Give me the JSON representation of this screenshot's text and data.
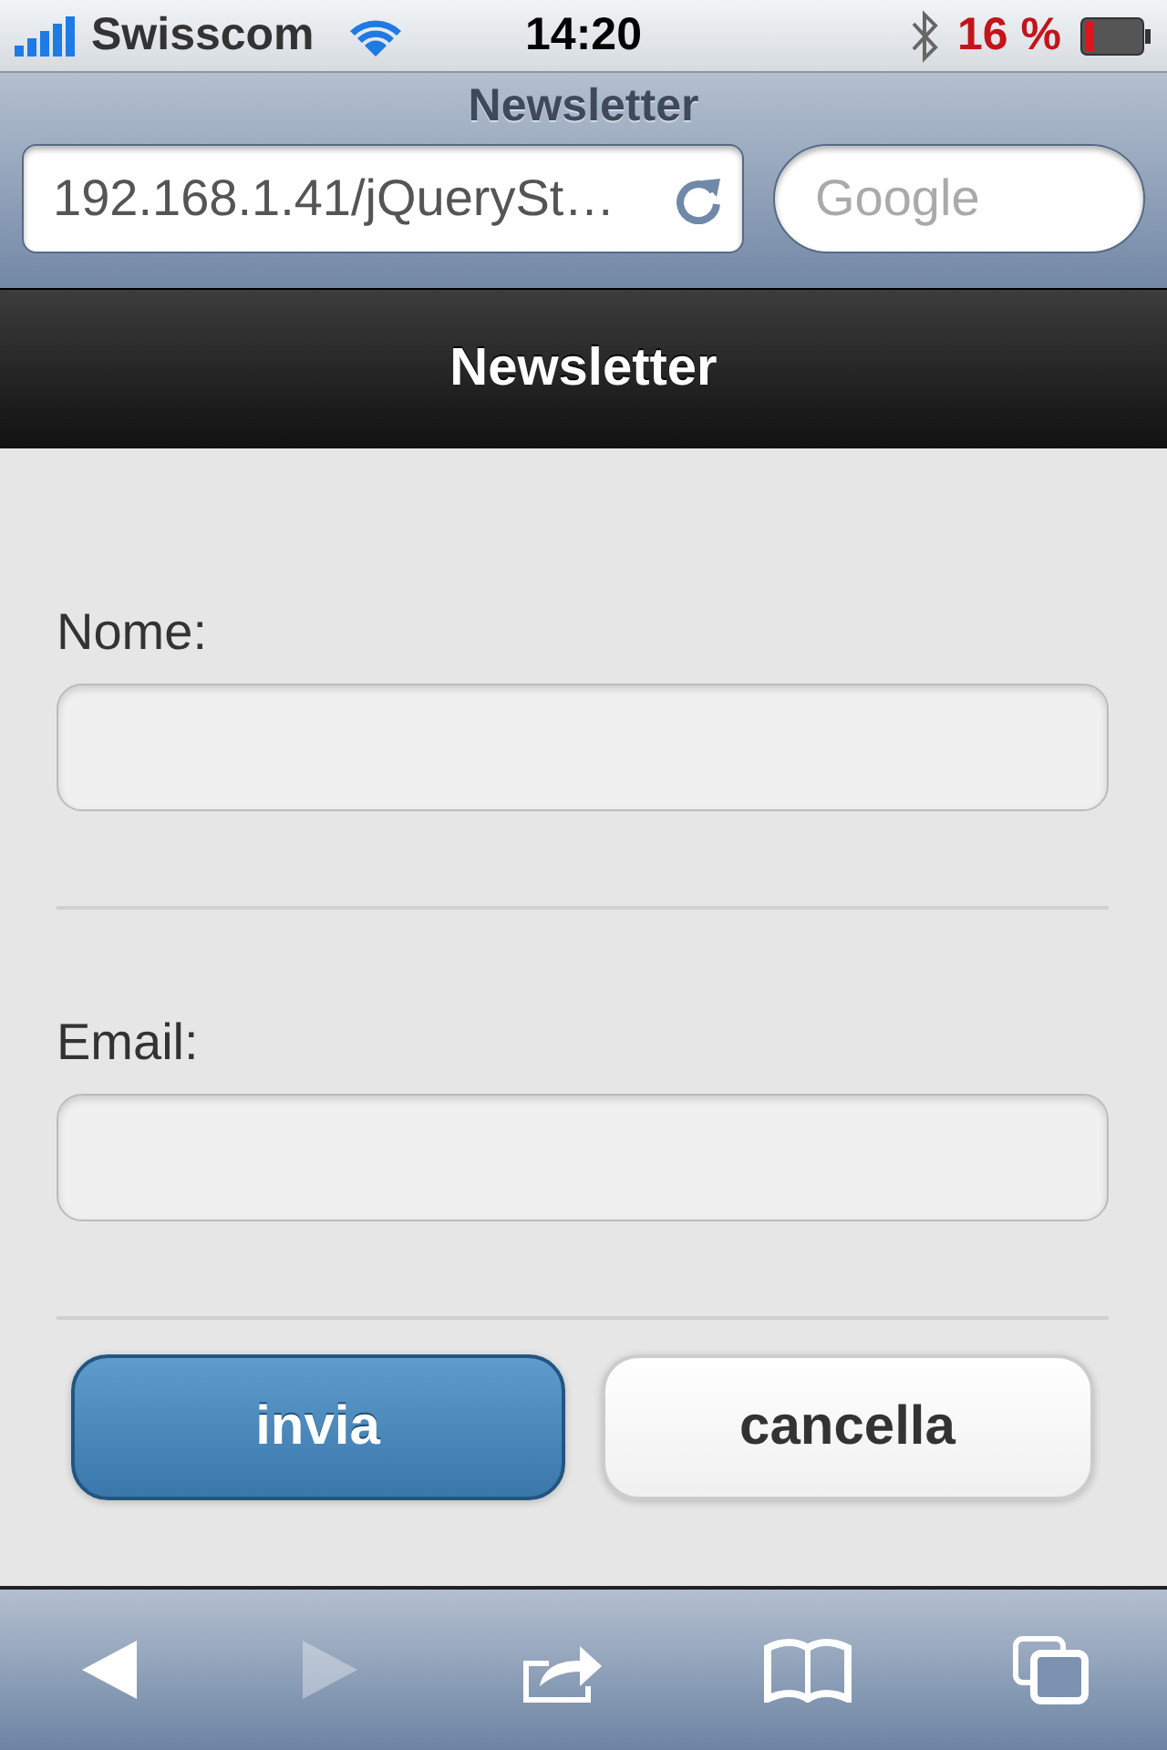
{
  "status_bar": {
    "carrier": "Swisscom",
    "time": "14:20",
    "battery": "16 %"
  },
  "browser": {
    "title": "Newsletter",
    "url": "192.168.1.41/jQuerySt…",
    "search": {
      "placeholder": "Google"
    }
  },
  "header": {
    "title": "Newsletter"
  },
  "form": {
    "fields": [
      {
        "label": "Nome:"
      },
      {
        "label": "Email:"
      }
    ],
    "buttons": [
      {
        "label": "invia",
        "kind": "primary"
      },
      {
        "label": "cancella",
        "kind": "secondary"
      }
    ]
  },
  "toolbar": [
    {
      "kind": "back",
      "disabled": false
    },
    {
      "kind": "forward",
      "disabled": true
    },
    {
      "kind": "share",
      "disabled": false
    },
    {
      "kind": "bookmarks",
      "disabled": false
    },
    {
      "kind": "tabs",
      "disabled": false
    }
  ]
}
